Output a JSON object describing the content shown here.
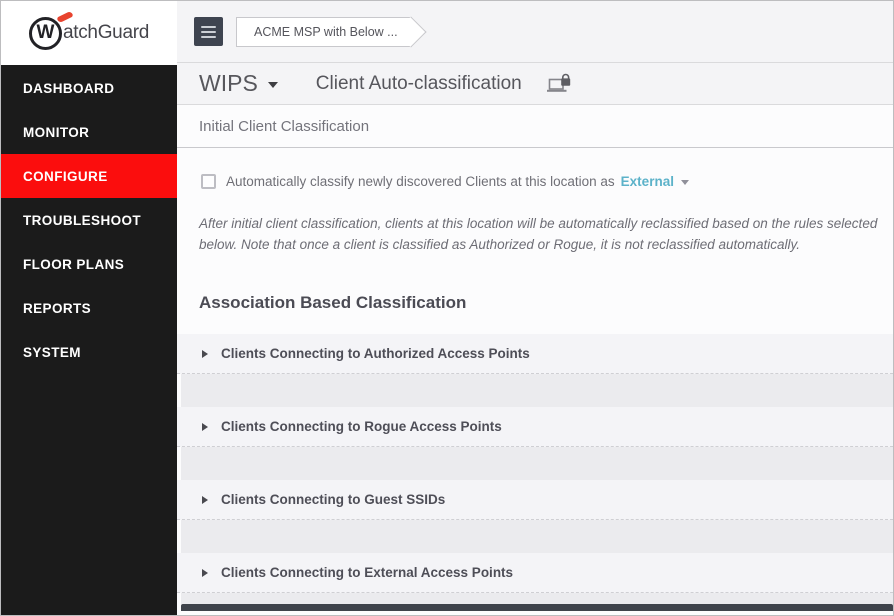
{
  "brand": {
    "logo_w": "W",
    "logo_rest": "atchGuard"
  },
  "sidebar": {
    "items": [
      {
        "label": "DASHBOARD",
        "active": false
      },
      {
        "label": "MONITOR",
        "active": false
      },
      {
        "label": "CONFIGURE",
        "active": true
      },
      {
        "label": "TROUBLESHOOT",
        "active": false
      },
      {
        "label": "FLOOR PLANS",
        "active": false
      },
      {
        "label": "REPORTS",
        "active": false
      },
      {
        "label": "SYSTEM",
        "active": false
      }
    ]
  },
  "topbar": {
    "breadcrumb": "ACME MSP with Below ..."
  },
  "page": {
    "menu_label": "WIPS",
    "title": "Client Auto-classification",
    "initial_header": "Initial Client Classification",
    "checkbox_label": "Automatically classify newly discovered Clients at this location as",
    "checkbox_checked": false,
    "classification_value": "External",
    "note": "After initial client classification, clients at this location will be automatically reclassified based on the rules selected below. Note that once a client is classified as Authorized or Rogue, it is not reclassified automatically.",
    "association_heading": "Association Based Classification",
    "sections": [
      {
        "title": "Clients Connecting to Authorized Access Points",
        "expanded": false
      },
      {
        "title": "Clients Connecting to Rogue Access Points",
        "expanded": false
      },
      {
        "title": "Clients Connecting to Guest SSIDs",
        "expanded": false
      },
      {
        "title": "Clients Connecting to External Access Points",
        "expanded": false
      }
    ]
  },
  "colors": {
    "accent_red": "#fb0d0d",
    "link_blue": "#5cb2c9",
    "sidebar_bg": "#1b1b1b",
    "swoosh_red": "#e8432e"
  }
}
